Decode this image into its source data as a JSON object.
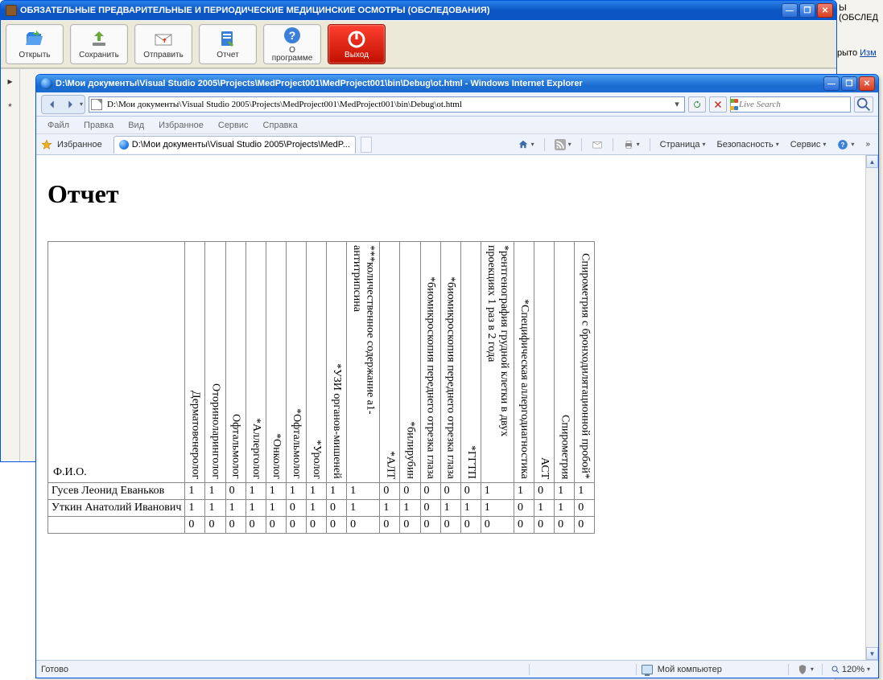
{
  "bg": {
    "text1": "Ы (ОБСЛЕД",
    "text2": "рыто",
    "link": "Изм"
  },
  "app": {
    "title": "ОБЯЗАТЕЛЬНЫЕ ПРЕДВАРИТЕЛЬНЫЕ И ПЕРИОДИЧЕСКИЕ МЕДИЦИНСКИЕ ОСМОТРЫ (ОБСЛЕДОВАНИЯ)",
    "toolbar": {
      "open": "Открыть",
      "save": "Сохранить",
      "send": "Отправить",
      "report": "Отчет",
      "about": "О\nпрограмме",
      "exit": "Выход"
    },
    "side1": "▸",
    "side2": "*"
  },
  "browser": {
    "title": "D:\\Мои документы\\Visual Studio 2005\\Projects\\MedProject001\\MedProject001\\bin\\Debug\\ot.html - Windows Internet Explorer",
    "address": "D:\\Мои документы\\Visual Studio 2005\\Projects\\MedProject001\\MedProject001\\bin\\Debug\\ot.html",
    "search_placeholder": "Live Search",
    "menu": {
      "file": "Файл",
      "edit": "Правка",
      "view": "Вид",
      "favorites": "Избранное",
      "tools": "Сервис",
      "help": "Справка"
    },
    "cmd": {
      "favorites": "Избранное",
      "tab": "D:\\Мои документы\\Visual Studio 2005\\Projects\\MedP...",
      "page": "Страница",
      "safety": "Безопасность",
      "service": "Сервис"
    },
    "status": {
      "ready": "Готово",
      "zone": "Мой компьютер",
      "zoom": "120%"
    }
  },
  "report": {
    "heading": "Отчет",
    "fio_header": "Ф.И.О.",
    "columns": [
      "Дерматовенеролог",
      "Оториноларинголог",
      "Офтальмолог",
      "*Аллерголог",
      "*Онколог",
      "*Офтальмолог",
      "*Уролог",
      "*УЗИ органов-мишеней",
      "***количественное содержание a1-антитрипсина",
      "*АЛТ",
      "*билирубин",
      "*биомикроскопия переднего отрезка глаза",
      "*биомикроскопия переднего отрезка глаза",
      "*ГГТП",
      "*рентгенография грудной клетки в двух проекциях 1 раз в 2 года",
      "*Специфическая аллергодиагностика",
      "АСТ",
      "Спирометрия",
      "Спирометрия с бронходилятационной пробой*"
    ],
    "rows": [
      {
        "name": "Гусев Леонид Еваньков",
        "values": [
          1,
          1,
          0,
          1,
          1,
          1,
          1,
          1,
          1,
          0,
          0,
          0,
          0,
          0,
          1,
          1,
          0,
          1,
          1
        ]
      },
      {
        "name": "Уткин Анатолий Иванович",
        "values": [
          1,
          1,
          1,
          1,
          1,
          0,
          1,
          0,
          1,
          1,
          1,
          0,
          1,
          1,
          1,
          0,
          1,
          1,
          0
        ]
      }
    ],
    "totals": [
      0,
      0,
      0,
      0,
      0,
      0,
      0,
      0,
      0,
      0,
      0,
      0,
      0,
      0,
      0,
      0,
      0,
      0,
      0
    ]
  }
}
